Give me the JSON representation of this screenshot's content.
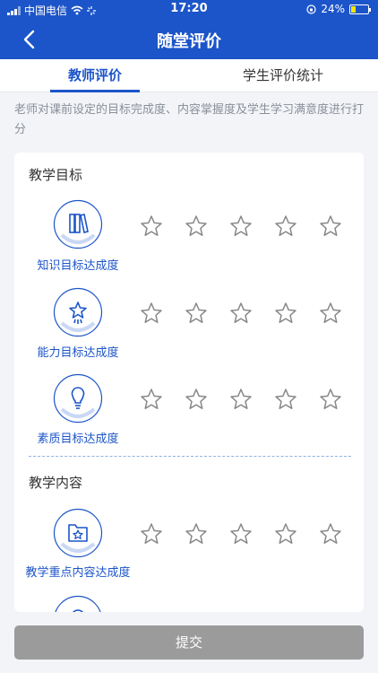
{
  "status_bar": {
    "carrier": "中国电信",
    "time": "17:20",
    "battery": "24%"
  },
  "nav": {
    "title": "随堂评价"
  },
  "tabs": [
    {
      "label": "教师评价",
      "active": true
    },
    {
      "label": "学生评价统计",
      "active": false
    }
  ],
  "description": "老师对课前设定的目标完成度、内容掌握度及学生学习满意度进行打分",
  "sections": [
    {
      "title": "教学目标",
      "items": [
        {
          "label": "知识目标达成度",
          "icon": "books-icon",
          "rating": 0,
          "max_rating": 5
        },
        {
          "label": "能力目标达成度",
          "icon": "star-rocket-icon",
          "rating": 0,
          "max_rating": 5
        },
        {
          "label": "素质目标达成度",
          "icon": "lightbulb-icon",
          "rating": 0,
          "max_rating": 5
        }
      ]
    },
    {
      "title": "教学内容",
      "items": [
        {
          "label": "教学重点内容达成度",
          "icon": "folder-star-icon",
          "rating": 0,
          "max_rating": 5
        }
      ]
    }
  ],
  "submit_label": "提交",
  "colors": {
    "primary": "#1c55c9",
    "submit_disabled": "#9b9b9b",
    "star_outline": "#888888"
  }
}
